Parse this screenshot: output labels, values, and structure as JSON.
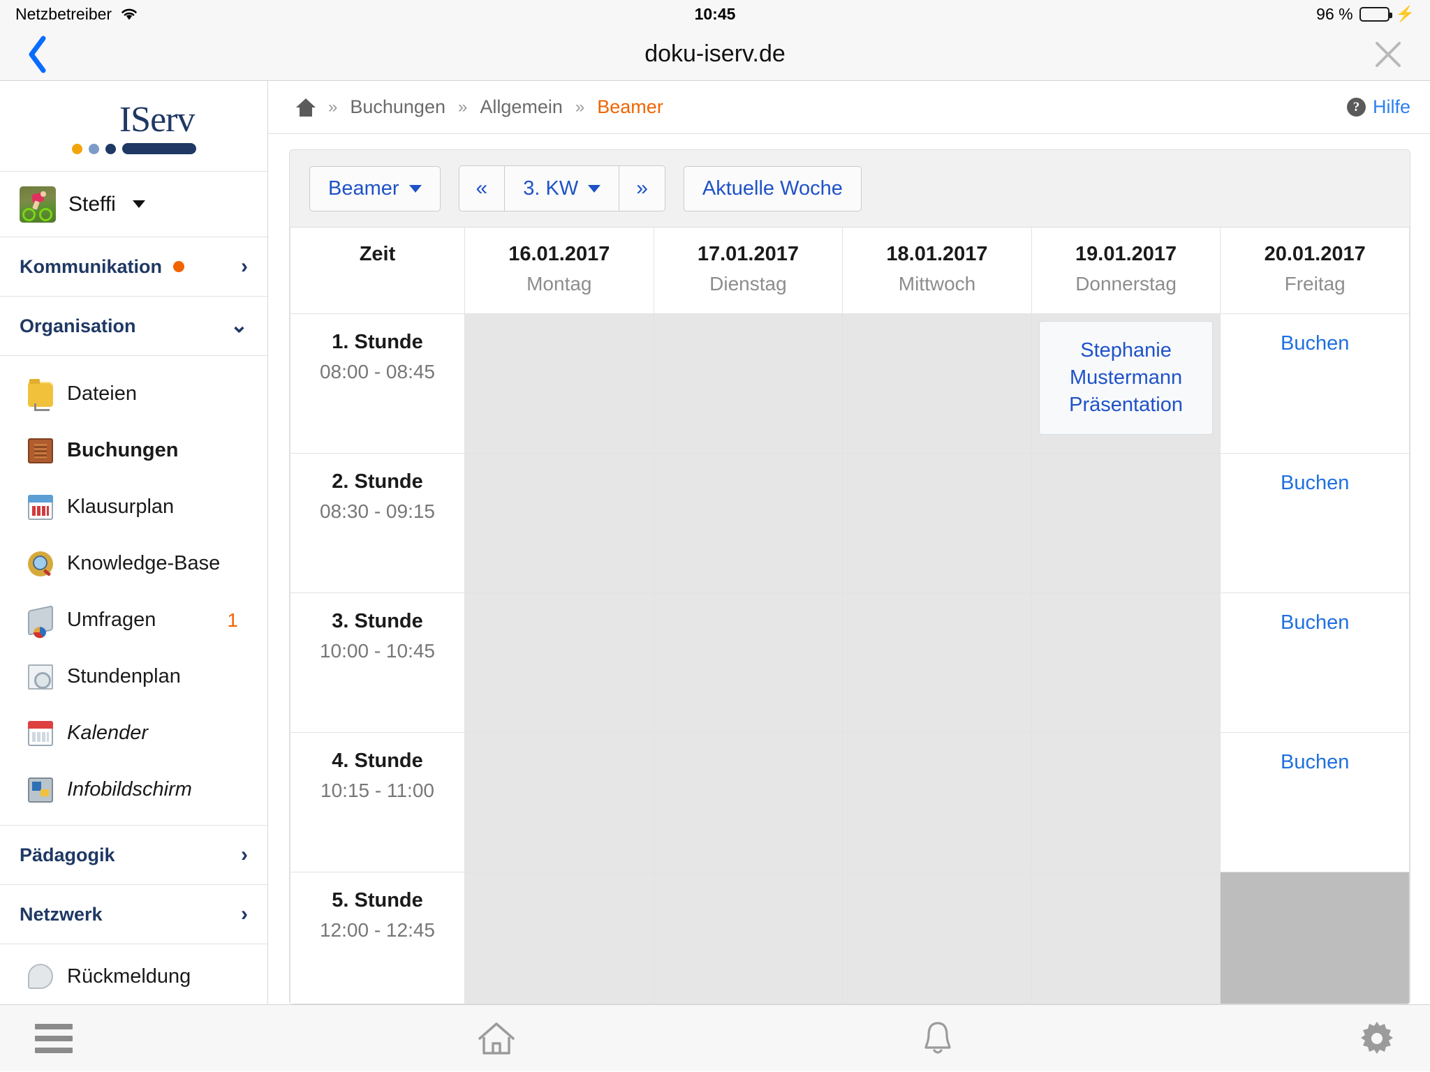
{
  "status_bar": {
    "carrier": "Netzbetreiber",
    "wifi_icon": "wifi-icon",
    "time": "10:45",
    "battery_percent": "96 %",
    "battery_fill": 96,
    "charging_icon": "lightning-bolt-icon",
    "battery_color": "#33cc55"
  },
  "nav_bar": {
    "back_icon": "chevron-left-icon",
    "title": "doku-iserv.de",
    "close_icon": "close-icon"
  },
  "sidebar": {
    "logo": {
      "text": "IServ",
      "dot_colors": [
        "#f2a50a",
        "#7d9bc8",
        "#1f3864"
      ],
      "bar_color": "#1f3864"
    },
    "user": {
      "name": "Steffi",
      "avatar_icon": "cyclist-avatar",
      "caret_icon": "caret-down-icon"
    },
    "sections": [
      {
        "title": "Kommunikation",
        "badge_dot": true,
        "badge_color": "#f06400",
        "chevron": "›",
        "expanded": false
      },
      {
        "title": "Organisation",
        "badge_dot": false,
        "chevron": "⌄",
        "expanded": true
      }
    ],
    "organisation_items": [
      {
        "label": "Dateien",
        "icon": "folder-icon",
        "active": false,
        "italic": false,
        "badge": ""
      },
      {
        "label": "Buchungen",
        "icon": "cabinet-icon",
        "active": true,
        "italic": false,
        "badge": ""
      },
      {
        "label": "Klausurplan",
        "icon": "calendar-blue-icon",
        "active": false,
        "italic": false,
        "badge": ""
      },
      {
        "label": "Knowledge-Base",
        "icon": "knowledge-base-icon",
        "active": false,
        "italic": false,
        "badge": ""
      },
      {
        "label": "Umfragen",
        "icon": "poll-icon",
        "active": false,
        "italic": false,
        "badge": "1"
      },
      {
        "label": "Stundenplan",
        "icon": "timetable-doc-icon",
        "active": false,
        "italic": false,
        "badge": ""
      },
      {
        "label": "Kalender",
        "icon": "calendar-red-icon",
        "active": false,
        "italic": true,
        "badge": ""
      },
      {
        "label": "Infobildschirm",
        "icon": "info-screen-icon",
        "active": false,
        "italic": true,
        "badge": ""
      }
    ],
    "lower_sections": [
      {
        "title": "Pädagogik",
        "chevron": "›"
      },
      {
        "title": "Netzwerk",
        "chevron": "›"
      }
    ],
    "feedback": {
      "label": "Rückmeldung",
      "icon": "speech-bubble-icon"
    }
  },
  "breadcrumb": {
    "home_icon": "home-icon",
    "separator": "»",
    "items": [
      "Buchungen",
      "Allgemein"
    ],
    "current": "Beamer",
    "current_color": "#f06400"
  },
  "help": {
    "icon": "question-circle-icon",
    "label": "Hilfe",
    "color": "#2d7ff0"
  },
  "toolbar": {
    "resource_label": "Beamer",
    "prev_label": "«",
    "week_label": "3. KW",
    "next_label": "»",
    "current_week_label": "Aktuelle Woche"
  },
  "table": {
    "time_header": "Zeit",
    "days": [
      {
        "date": "16.01.2017",
        "day": "Montag"
      },
      {
        "date": "17.01.2017",
        "day": "Dienstag"
      },
      {
        "date": "18.01.2017",
        "day": "Mittwoch"
      },
      {
        "date": "19.01.2017",
        "day": "Donnerstag"
      },
      {
        "date": "20.01.2017",
        "day": "Freitag"
      }
    ],
    "book_label": "Buchen",
    "rows": [
      {
        "period": "1. Stunde",
        "time": "08:00 - 08:45",
        "cells": [
          {
            "state": "blocked"
          },
          {
            "state": "blocked"
          },
          {
            "state": "blocked"
          },
          {
            "state": "booked",
            "lines": [
              "Stephanie",
              "Mustermann",
              "Präsentation"
            ]
          },
          {
            "state": "free"
          }
        ]
      },
      {
        "period": "2. Stunde",
        "time": "08:30 - 09:15",
        "cells": [
          {
            "state": "blocked"
          },
          {
            "state": "blocked"
          },
          {
            "state": "blocked"
          },
          {
            "state": "blocked"
          },
          {
            "state": "free"
          }
        ]
      },
      {
        "period": "3. Stunde",
        "time": "10:00 - 10:45",
        "cells": [
          {
            "state": "blocked"
          },
          {
            "state": "blocked"
          },
          {
            "state": "blocked"
          },
          {
            "state": "blocked"
          },
          {
            "state": "free"
          }
        ]
      },
      {
        "period": "4. Stunde",
        "time": "10:15 - 11:00",
        "cells": [
          {
            "state": "blocked"
          },
          {
            "state": "blocked"
          },
          {
            "state": "blocked"
          },
          {
            "state": "blocked"
          },
          {
            "state": "free"
          }
        ]
      },
      {
        "period": "5. Stunde",
        "time": "12:00 - 12:45",
        "cells": [
          {
            "state": "blocked"
          },
          {
            "state": "blocked"
          },
          {
            "state": "blocked"
          },
          {
            "state": "blocked"
          },
          {
            "state": "scrollbar"
          }
        ]
      }
    ]
  },
  "bottom_bar": {
    "items": [
      {
        "icon": "hamburger-menu-icon",
        "name": "menu"
      },
      {
        "icon": "home-icon",
        "name": "home"
      },
      {
        "icon": "bell-icon",
        "name": "notifications"
      },
      {
        "icon": "gear-icon",
        "name": "settings"
      }
    ]
  }
}
